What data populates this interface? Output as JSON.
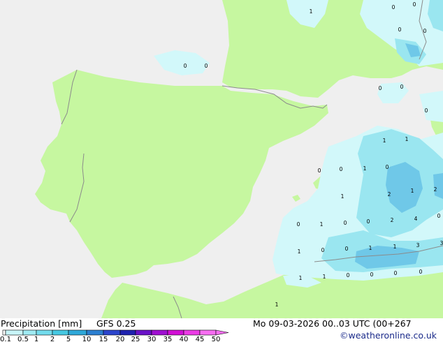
{
  "footer": {
    "title": "Precipitation [mm]",
    "model": "GFS 0.25",
    "datetime": "Mo 09-03-2026 00..03 UTC (00+267",
    "credit": "©weatheronline.co.uk"
  },
  "legend": {
    "labels": [
      "0.1",
      "0.5",
      "1",
      "2",
      "5",
      "10",
      "15",
      "20",
      "25",
      "30",
      "35",
      "40",
      "45",
      "50"
    ],
    "colors": [
      "#ffffff",
      "#c8f5f8",
      "#a0ebf3",
      "#73dced",
      "#46c8e2",
      "#2fa8d9",
      "#2b7fd1",
      "#2b45cc",
      "#1f22b0",
      "#6a12c8",
      "#a010d2",
      "#d20fd6",
      "#ec3be6",
      "#f76ef2"
    ]
  },
  "colors": {
    "sea": "#efefef",
    "land": "#c6f7a0",
    "border": "#8b8b8b",
    "precip_light": "#d2f8fa",
    "precip_medium": "#9ae6f0",
    "precip_heavy": "#6fc8e8"
  },
  "map_values": [
    "1",
    "0",
    "0",
    "0",
    "0",
    "0",
    "0",
    "0",
    "0",
    "1",
    "1",
    "0",
    "0",
    "1",
    "0",
    "2",
    "1",
    "1",
    "2",
    "0",
    "1",
    "4",
    "0",
    "0",
    "2",
    "0",
    "1",
    "0",
    "0",
    "1",
    "1",
    "3",
    "3",
    "1",
    "1",
    "0",
    "0",
    "0",
    "0",
    "1",
    "0"
  ]
}
